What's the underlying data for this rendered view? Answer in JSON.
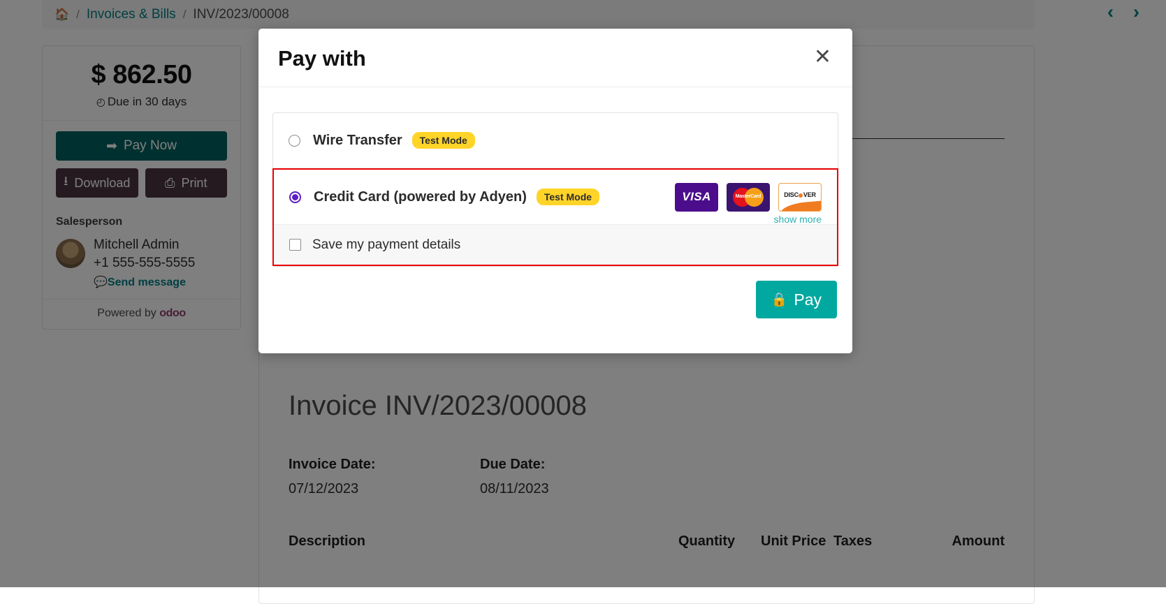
{
  "breadcrumb": {
    "home_icon": "home-icon",
    "separator": "/",
    "parent_label": "Invoices & Bills",
    "current_label": "INV/2023/00008"
  },
  "nav": {
    "prev_icon": "chevron-left-icon",
    "next_icon": "chevron-right-icon",
    "prev_glyph": "‹",
    "next_glyph": "›"
  },
  "sidebar": {
    "amount": "$ 862.50",
    "due_icon": "clock-icon",
    "due_glyph": "◴",
    "due_text": "Due in 30 days",
    "pay_now_label": "Pay Now",
    "pay_now_icon": "arrow-circle-right-icon",
    "pay_now_glyph": "➡",
    "download_label": "Download",
    "download_icon": "download-icon",
    "download_glyph": "⭳",
    "print_label": "Print",
    "print_icon": "printer-icon",
    "print_glyph": "⎙",
    "salesperson_title": "Salesperson",
    "salesperson_name": "Mitchell Admin",
    "salesperson_phone": "+1 555-555-5555",
    "send_message_label": "Send message",
    "send_message_icon": "comment-icon",
    "send_message_glyph": "💬",
    "powered_prefix": "Powered by ",
    "powered_brand": "odoo"
  },
  "invoice": {
    "title": "Invoice INV/2023/00008",
    "invoice_date_label": "Invoice Date:",
    "invoice_date_value": "07/12/2023",
    "due_date_label": "Due Date:",
    "due_date_value": "08/11/2023",
    "columns": {
      "description": "Description",
      "quantity": "Quantity",
      "unit_price": "Unit Price",
      "taxes": "Taxes",
      "amount": "Amount"
    }
  },
  "modal": {
    "title": "Pay with",
    "close_icon": "close-icon",
    "close_glyph": "✕",
    "options": [
      {
        "id": "wire-transfer",
        "label": "Wire Transfer",
        "badge": "Test Mode",
        "selected": false
      },
      {
        "id": "credit-card-adyen",
        "label": "Credit Card (powered by Adyen)",
        "badge": "Test Mode",
        "selected": true,
        "brands": [
          {
            "name": "visa",
            "text": "VISA"
          },
          {
            "name": "mastercard",
            "text": "MasterCard"
          },
          {
            "name": "discover",
            "text_before": "DISC",
            "text_after": "VER"
          }
        ],
        "show_more_label": "show more"
      }
    ],
    "save_details_label": "Save my payment details",
    "save_details_checked": false,
    "pay_label": "Pay",
    "pay_icon": "lock-icon",
    "pay_glyph": "🔒"
  },
  "colors": {
    "teal_link": "#017e84",
    "pay_now_bg": "#00605f",
    "pay_btn_bg": "#00a8a0",
    "badge_bg": "#ffd428",
    "highlight_border": "#ec0000",
    "radio_checked": "#5b1fc4",
    "show_more_link": "#2bb0b3"
  }
}
